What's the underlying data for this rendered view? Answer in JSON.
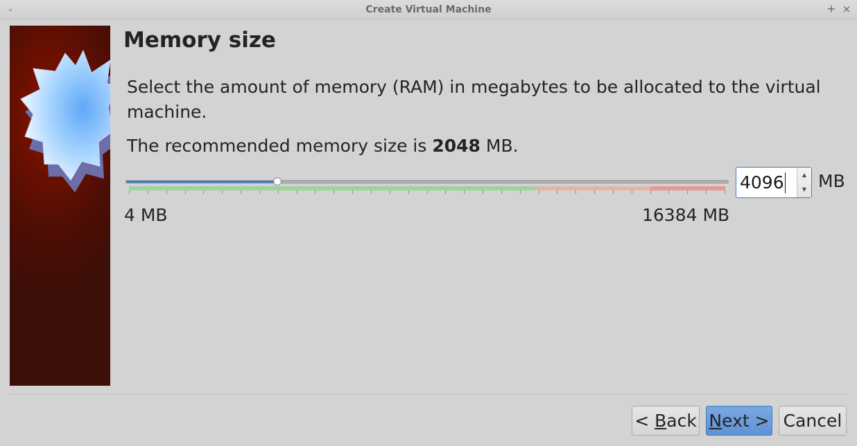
{
  "window": {
    "title": "Create Virtual Machine",
    "menu_glyph": "⌄",
    "maximize_glyph": "+",
    "close_glyph": "×"
  },
  "page": {
    "heading": "Memory size",
    "description": "Select the amount of memory (RAM) in megabytes to be allocated to the virtual machine.",
    "recommended_prefix": "The recommended memory size is",
    "recommended_value": "2048",
    "recommended_unit": "MB."
  },
  "memory": {
    "min_mb": 4,
    "max_mb": 16384,
    "current_mb": 4096,
    "value_text": "4096",
    "unit": "MB",
    "min_label": "4 MB",
    "max_label": "16384 MB",
    "legend_colors": {
      "safe": "#9ed39b",
      "warn": "#e3b6a0",
      "danger": "#e39a9a"
    },
    "legend_fractions": {
      "safe": 0.68,
      "warn": 0.195,
      "danger": 0.125
    }
  },
  "buttons": {
    "back": {
      "prefix": "< ",
      "accel": "B",
      "rest": "ack"
    },
    "next": {
      "accel": "N",
      "rest": "ext >"
    },
    "cancel": "Cancel"
  },
  "colors": {
    "accent": "#3f7bc9",
    "window_bg": "#d3d3d3",
    "banner_bg": "#4a0e05"
  },
  "icons": {
    "banner": "virtualbox-starburst-icon"
  }
}
